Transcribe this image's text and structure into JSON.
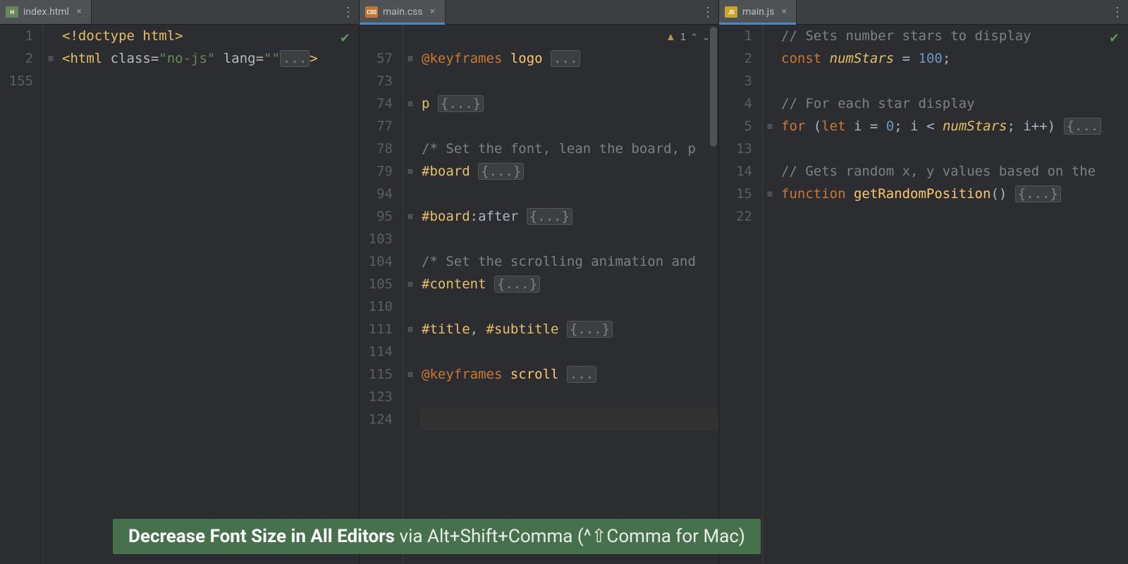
{
  "tip": {
    "bold": "Decrease Font Size in All Editors",
    "rest": " via Alt+Shift+Comma (^⇧Comma for Mac)"
  },
  "panes": {
    "html": {
      "tab": {
        "icon": "H",
        "name": "index.html"
      },
      "gutter": [
        "1",
        "2",
        "155"
      ],
      "lines": [
        {
          "html": "<span class='tagc'>&lt;!doctype html&gt;</span>"
        },
        {
          "fold": true,
          "html": "<span class='tagc'>&lt;html </span><span class='attr'>class=</span><span class='str'>\"no-js\"</span> <span class='attr'>lang=</span><span class='str'>\"\"</span><span class='folded'>...</span><span class='tagc'>&gt;</span>"
        },
        {
          "html": ""
        }
      ],
      "status": "ok"
    },
    "css": {
      "tab": {
        "icon": "CSS",
        "name": "main.css"
      },
      "gutter": [
        "",
        "57",
        "73",
        "74",
        "77",
        "78",
        "79",
        "94",
        "95",
        "103",
        "104",
        "105",
        "110",
        "111",
        "114",
        "115",
        "123",
        "124"
      ],
      "lines": [
        {
          "html": "<span class='cmt'></span>"
        },
        {
          "fold": true,
          "html": "<span class='kw'>@keyframes</span> <span class='fn'>logo</span> <span class='folded'>...</span>"
        },
        {
          "html": ""
        },
        {
          "fold": true,
          "html": "<span class='id'>p</span> <span class='folded'>{...}</span>"
        },
        {
          "html": ""
        },
        {
          "html": "<span class='cmt'>/* Set the font, lean the board, p</span>"
        },
        {
          "fold": true,
          "html": "<span class='id'>#board</span> <span class='folded'>{...}</span>"
        },
        {
          "html": ""
        },
        {
          "fold": true,
          "html": "<span class='id'>#board</span><span class='punct'>:after</span> <span class='folded'>{...}</span>"
        },
        {
          "html": ""
        },
        {
          "html": "<span class='cmt'>/* Set the scrolling animation and</span>"
        },
        {
          "fold": true,
          "html": "<span class='id'>#content</span> <span class='folded'>{...}</span>"
        },
        {
          "html": ""
        },
        {
          "fold": true,
          "html": "<span class='id'>#title</span><span class='punct'>, </span><span class='id'>#subtitle</span> <span class='folded'>{...}</span>"
        },
        {
          "html": ""
        },
        {
          "fold": true,
          "html": "<span class='kw'>@keyframes</span> <span class='fn'>scroll</span> <span class='folded'>...</span>"
        },
        {
          "html": ""
        },
        {
          "current": true,
          "html": ""
        }
      ],
      "status": "warn",
      "warnCount": "1"
    },
    "js": {
      "tab": {
        "icon": "JS",
        "name": "main.js"
      },
      "gutter": [
        "1",
        "2",
        "3",
        "4",
        "5",
        "13",
        "14",
        "15",
        "22"
      ],
      "lines": [
        {
          "html": "<span class='cmt'>// Sets number stars to display</span>"
        },
        {
          "html": "<span class='kw'>const</span> <span class='id ital'>numStars</span> <span class='punct'>=</span> <span class='num'>100</span><span class='punct'>;</span>"
        },
        {
          "html": ""
        },
        {
          "html": "<span class='cmt'>// For each star display</span>"
        },
        {
          "fold": true,
          "html": "<span class='kw'>for</span> <span class='punct'>(</span><span class='kw'>let</span> i <span class='punct'>=</span> <span class='num'>0</span><span class='punct'>;</span> i <span class='punct'>&lt;</span> <span class='id ital'>numStars</span><span class='punct'>;</span> i<span class='punct'>++) </span><span class='folded'>{...</span>"
        },
        {
          "html": ""
        },
        {
          "html": "<span class='cmt'>// Gets random x, y values based on the</span>"
        },
        {
          "fold": true,
          "html": "<span class='kw'>function</span> <span class='fn'>getRandomPosition</span><span class='punct'>()</span> <span class='folded'>{...}</span>"
        },
        {
          "html": ""
        }
      ],
      "status": "ok"
    }
  }
}
